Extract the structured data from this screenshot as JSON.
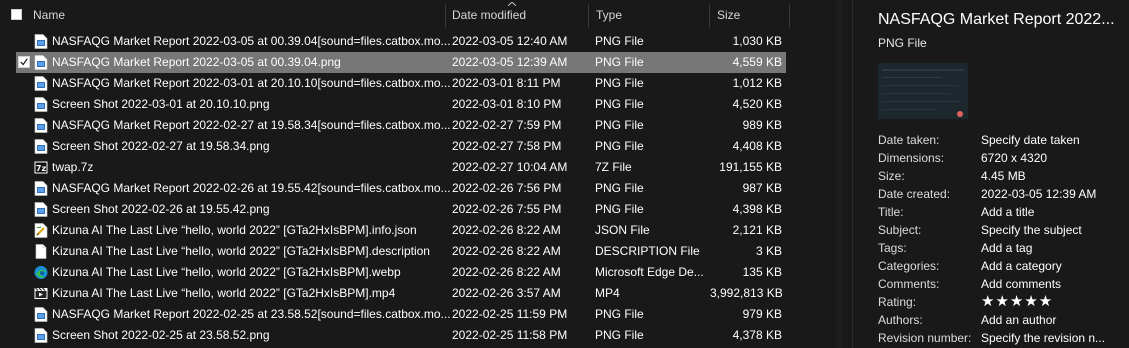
{
  "columns": {
    "name": "Name",
    "date": "Date modified",
    "type": "Type",
    "size": "Size"
  },
  "files": [
    {
      "name": "NASFAQG Market Report 2022-03-05 at 00.39.04[sound=files.catbox.mo...",
      "date": "2022-03-05 12:40 AM",
      "type": "PNG File",
      "size": "1,030 KB",
      "icon": "png-file-icon",
      "selected": false
    },
    {
      "name": "NASFAQG Market Report 2022-03-05 at 00.39.04.png",
      "date": "2022-03-05 12:39 AM",
      "type": "PNG File",
      "size": "4,559 KB",
      "icon": "png-file-icon",
      "selected": true
    },
    {
      "name": "NASFAQG Market Report 2022-03-01 at 20.10.10[sound=files.catbox.mo...",
      "date": "2022-03-01 8:11 PM",
      "type": "PNG File",
      "size": "1,012 KB",
      "icon": "png-file-icon",
      "selected": false
    },
    {
      "name": "Screen Shot 2022-03-01 at 20.10.10.png",
      "date": "2022-03-01 8:10 PM",
      "type": "PNG File",
      "size": "4,520 KB",
      "icon": "png-file-icon",
      "selected": false
    },
    {
      "name": "NASFAQG Market Report 2022-02-27 at 19.58.34[sound=files.catbox.mo...",
      "date": "2022-02-27 7:59 PM",
      "type": "PNG File",
      "size": "989 KB",
      "icon": "png-file-icon",
      "selected": false
    },
    {
      "name": "Screen Shot 2022-02-27 at 19.58.34.png",
      "date": "2022-02-27 7:58 PM",
      "type": "PNG File",
      "size": "4,408 KB",
      "icon": "png-file-icon",
      "selected": false
    },
    {
      "name": "twap.7z",
      "date": "2022-02-27 10:04 AM",
      "type": "7Z File",
      "size": "191,155 KB",
      "icon": "7z-archive-icon",
      "selected": false
    },
    {
      "name": "NASFAQG Market Report 2022-02-26 at 19.55.42[sound=files.catbox.mo...",
      "date": "2022-02-26 7:56 PM",
      "type": "PNG File",
      "size": "987 KB",
      "icon": "png-file-icon",
      "selected": false
    },
    {
      "name": "Screen Shot 2022-02-26 at 19.55.42.png",
      "date": "2022-02-26 7:55 PM",
      "type": "PNG File",
      "size": "4,398 KB",
      "icon": "png-file-icon",
      "selected": false
    },
    {
      "name": "Kizuna AI The Last Live “hello, world 2022” [GTa2HxIsBPM].info.json",
      "date": "2022-02-26 8:22 AM",
      "type": "JSON File",
      "size": "2,121 KB",
      "icon": "json-file-icon",
      "selected": false
    },
    {
      "name": "Kizuna AI The Last Live “hello, world 2022” [GTa2HxIsBPM].description",
      "date": "2022-02-26 8:22 AM",
      "type": "DESCRIPTION File",
      "size": "3 KB",
      "icon": "blank-file-icon",
      "selected": false
    },
    {
      "name": "Kizuna AI The Last Live “hello, world 2022” [GTa2HxIsBPM].webp",
      "date": "2022-02-26 8:22 AM",
      "type": "Microsoft Edge De...",
      "size": "135 KB",
      "icon": "edge-file-icon",
      "selected": false
    },
    {
      "name": "Kizuna AI The Last Live “hello, world 2022” [GTa2HxIsBPM].mp4",
      "date": "2022-02-26 3:57 AM",
      "type": "MP4",
      "size": "3,992,813 KB",
      "icon": "video-file-icon",
      "selected": false
    },
    {
      "name": "NASFAQG Market Report 2022-02-25 at 23.58.52[sound=files.catbox.mo...",
      "date": "2022-02-25 11:59 PM",
      "type": "PNG File",
      "size": "979 KB",
      "icon": "png-file-icon",
      "selected": false
    },
    {
      "name": "Screen Shot 2022-02-25 at 23.58.52.png",
      "date": "2022-02-25 11:58 PM",
      "type": "PNG File",
      "size": "4,378 KB",
      "icon": "png-file-icon",
      "selected": false
    }
  ],
  "details": {
    "title": "NASFAQG Market Report 2022...",
    "subtitle": "PNG File",
    "properties": [
      {
        "label": "Date taken:",
        "value": "Specify date taken"
      },
      {
        "label": "Dimensions:",
        "value": "6720 x 4320"
      },
      {
        "label": "Size:",
        "value": "4.45 MB"
      },
      {
        "label": "Date created:",
        "value": "2022-03-05 12:39 AM"
      },
      {
        "label": "Title:",
        "value": "Add a title"
      },
      {
        "label": "Subject:",
        "value": "Specify the subject"
      },
      {
        "label": "Tags:",
        "value": "Add a tag"
      },
      {
        "label": "Categories:",
        "value": "Add a category"
      },
      {
        "label": "Comments:",
        "value": "Add comments"
      },
      {
        "label": "Rating:",
        "value": "★★★★★",
        "stars": 0
      },
      {
        "label": "Authors:",
        "value": "Add an author"
      },
      {
        "label": "Revision number:",
        "value": "Specify the revision n..."
      }
    ]
  },
  "colors": {
    "background": "#191919",
    "selected_row": "#777777",
    "text": "#ffffff"
  }
}
